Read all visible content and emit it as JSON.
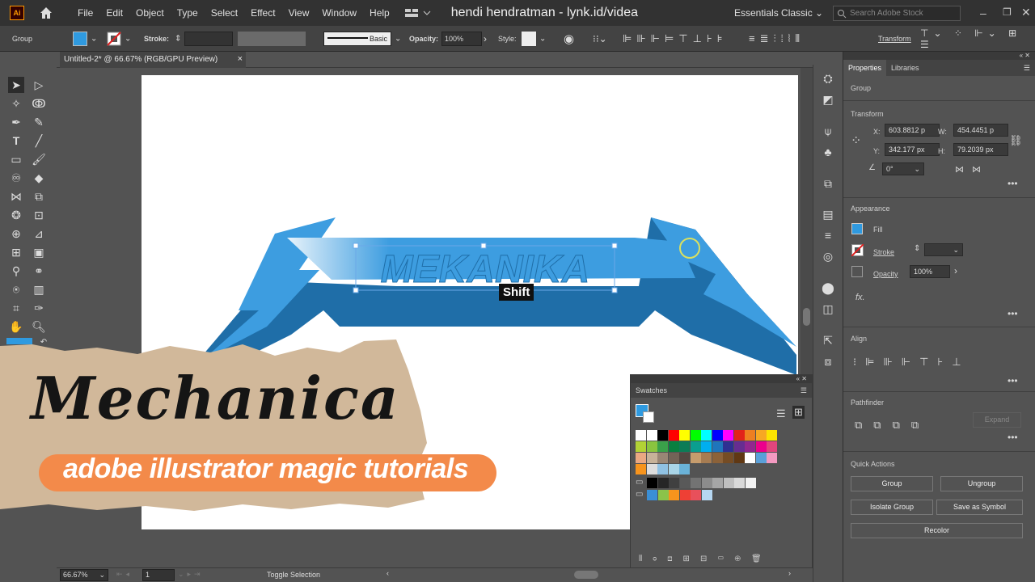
{
  "app": {
    "logo_text": "Ai",
    "title": "hendi hendratman - lynk.id/videa",
    "workspace": "Essentials Classic",
    "search_placeholder": "Search Adobe Stock"
  },
  "menu": [
    "File",
    "Edit",
    "Object",
    "Type",
    "Select",
    "Effect",
    "View",
    "Window",
    "Help"
  ],
  "control": {
    "selection": "Group",
    "stroke_label": "Stroke:",
    "brush": "Basic",
    "opacity_label": "Opacity:",
    "opacity": "100%",
    "style_label": "Style:",
    "transform": "Transform"
  },
  "document": {
    "tab": "Untitled-2* @ 66.67% (RGB/GPU Preview)",
    "close": "×"
  },
  "artwork": {
    "word": "MEKANIKA",
    "tooltip": "Shift"
  },
  "overlay": {
    "script_title": "Mechanica",
    "banner": "adobe illustrator magic tutorials"
  },
  "properties": {
    "tabs": [
      "Properties",
      "Libraries"
    ],
    "object": "Group",
    "transform": {
      "title": "Transform",
      "x_label": "X:",
      "x": "603.8812 p",
      "y_label": "Y:",
      "y": "342.177 px",
      "w_label": "W:",
      "w": "454.4451 p",
      "h_label": "H:",
      "h": "79.2039 px",
      "angle": "0°"
    },
    "appearance": {
      "title": "Appearance",
      "fill": "Fill",
      "stroke": "Stroke",
      "opacity_label": "Opacity",
      "opacity": "100%",
      "fx": "fx."
    },
    "align_title": "Align",
    "pathfinder": {
      "title": "Pathfinder",
      "expand": "Expand"
    },
    "quick_actions": {
      "title": "Quick Actions",
      "group": "Group",
      "ungroup": "Ungroup",
      "isolate": "Isolate Group",
      "symbol": "Save as Symbol",
      "recolor": "Recolor"
    }
  },
  "swatches": {
    "title": "Swatches"
  },
  "status": {
    "zoom": "66.67%",
    "artboard": "1",
    "action": "Toggle Selection"
  },
  "colors": {
    "fill": "#2f9ae0",
    "accent": "#f38a4a",
    "mekanika_light": "#3d9de0",
    "mekanika_dark": "#1f6ea8"
  }
}
